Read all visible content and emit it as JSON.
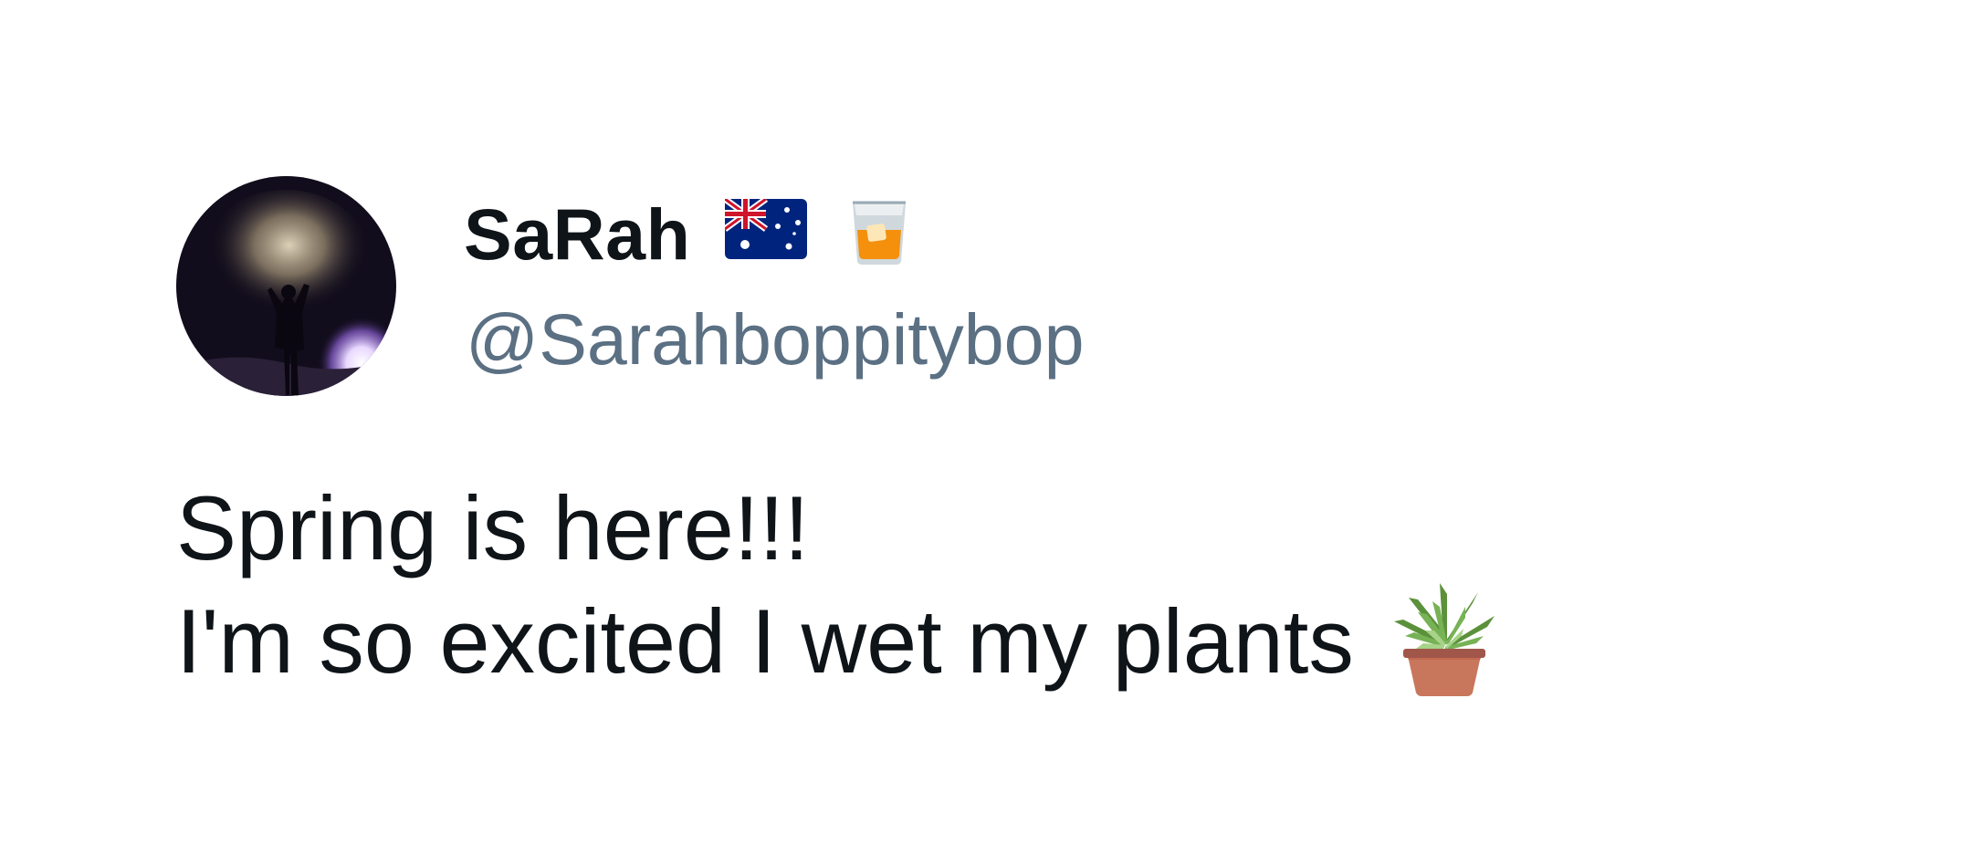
{
  "user": {
    "display_name": "SaRah",
    "username": "@Sarahboppitybop",
    "name_emojis": [
      "australia-flag-icon",
      "tumbler-glass-icon"
    ]
  },
  "tweet": {
    "lines": [
      "Spring is here!!!",
      "I'm so excited I wet my plants"
    ],
    "trailing_emoji": "potted-plant-icon"
  },
  "colors": {
    "background": "#ffffff",
    "name_text": "#0f1419",
    "username_text": "#5b7083",
    "body_text": "#0f1419"
  }
}
